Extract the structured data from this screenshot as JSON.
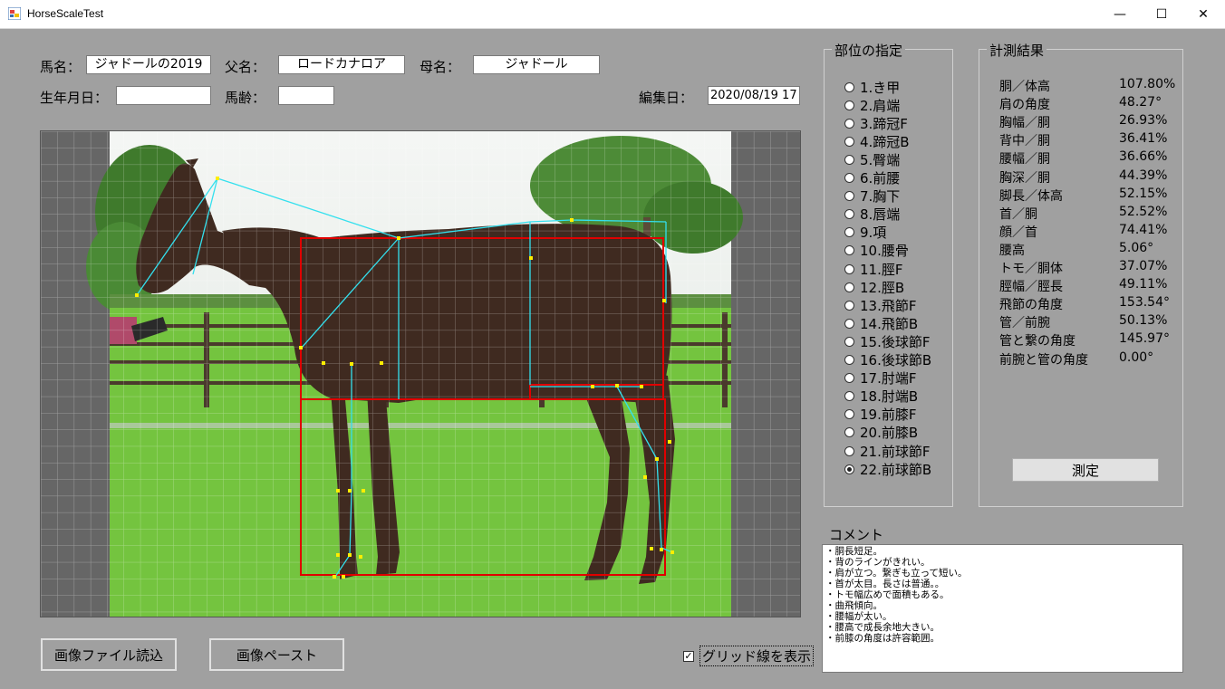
{
  "window": {
    "title": "HorseScaleTest",
    "minimize": "—",
    "maximize": "☐",
    "close": "✕"
  },
  "form": {
    "horse_name_label": "馬名：",
    "horse_name": "ジャドールの2019",
    "sire_label": "父名：",
    "sire": "ロードカナロア",
    "dam_label": "母名：",
    "dam": "ジャドール",
    "birthdate_label": "生年月日：",
    "birthdate": "",
    "age_label": "馬齢：",
    "age": "",
    "edit_date_label": "編集日：",
    "edit_date": "2020/08/19 17"
  },
  "parts": {
    "title": "部位の指定",
    "selected": "22.前球節B",
    "items": [
      "1.き甲",
      "2.肩端",
      "3.蹄冠F",
      "4.蹄冠B",
      "5.臀端",
      "6.前腰",
      "7.胸下",
      "8.唇端",
      "9.項",
      "10.腰骨",
      "11.脛F",
      "12.脛B",
      "13.飛節F",
      "14.飛節B",
      "15.後球節F",
      "16.後球節B",
      "17.肘端F",
      "18.肘端B",
      "19.前膝F",
      "20.前膝B",
      "21.前球節F",
      "22.前球節B"
    ]
  },
  "results": {
    "title": "計測結果",
    "rows": [
      {
        "name": "胴／体高",
        "value": "107.80%"
      },
      {
        "name": "肩の角度",
        "value": "48.27°"
      },
      {
        "name": "胸幅／胴",
        "value": "26.93%"
      },
      {
        "name": "背中／胴",
        "value": "36.41%"
      },
      {
        "name": "腰幅／胴",
        "value": "36.66%"
      },
      {
        "name": "胸深／胴",
        "value": "44.39%"
      },
      {
        "name": "脚長／体高",
        "value": "52.15%"
      },
      {
        "name": "首／胴",
        "value": "52.52%"
      },
      {
        "name": "顔／首",
        "value": "74.41%"
      },
      {
        "name": "腰高",
        "value": "5.06°"
      },
      {
        "name": "トモ／胴体",
        "value": "37.07%"
      },
      {
        "name": "脛幅／脛長",
        "value": "49.11%"
      },
      {
        "name": "飛節の角度",
        "value": "153.54°"
      },
      {
        "name": "管／前腕",
        "value": "50.13%"
      },
      {
        "name": "管と繋の角度",
        "value": "145.97°"
      },
      {
        "name": "前腕と管の角度",
        "value": "0.00°"
      }
    ],
    "measure_button": "測定"
  },
  "comment": {
    "label": "コメント",
    "lines": [
      "・胴長短足。",
      "・背のラインがきれい。",
      "・肩が立つ。繋ぎも立って短い。",
      "・首が太目。長さは普通。。",
      "・トモ幅広めで面積もある。",
      "・曲飛傾向。",
      "・腰幅が太い。",
      "・腰高で成長余地大きい。",
      "・前膝の角度は許容範囲。"
    ]
  },
  "buttons": {
    "load_image": "画像ファイル読込",
    "paste_image": "画像ペースト"
  },
  "grid_checkbox": {
    "label": "グリッド線を表示",
    "checked": true,
    "mark": "✓"
  },
  "colors": {
    "background": "#a0a0a0",
    "red_box": "#e00000",
    "cyan_line": "#33e0ee",
    "point": "#ffee00",
    "grass": "#6fc23a",
    "horse": "#3f2a20"
  }
}
